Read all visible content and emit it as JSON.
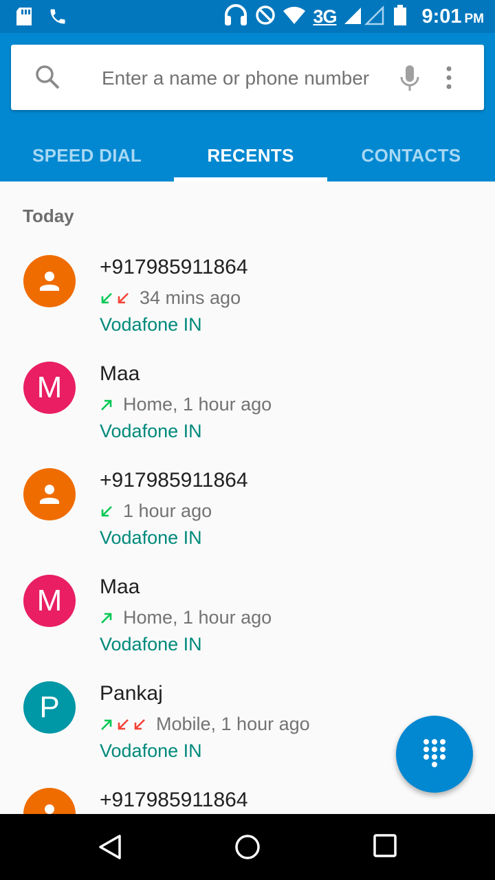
{
  "status_bar": {
    "network": "3G",
    "time": "9:01",
    "ampm": "PM",
    "icons": [
      "sd-card-icon",
      "phone-icon",
      "headset-icon",
      "do-not-disturb-icon",
      "wifi-icon",
      "signal-icon",
      "battery-icon"
    ]
  },
  "search": {
    "placeholder": "Enter a name or phone number",
    "icons": [
      "search-icon",
      "mic-icon",
      "more-vert-icon"
    ]
  },
  "tabs": [
    {
      "label": "SPEED DIAL",
      "active": false
    },
    {
      "label": "RECENTS",
      "active": true
    },
    {
      "label": "CONTACTS",
      "active": false
    }
  ],
  "section_header": "Today",
  "calls": [
    {
      "name": "+917985911864",
      "avatar": "person",
      "avatar_color": "#ef6c00",
      "arrows": [
        "incoming",
        "missed"
      ],
      "detail": "34 mins ago",
      "carrier": "Vodafone IN"
    },
    {
      "name": "Maa",
      "avatar": "M",
      "avatar_color": "#e91e63",
      "arrows": [
        "outgoing"
      ],
      "detail": "Home, 1 hour ago",
      "carrier": "Vodafone IN"
    },
    {
      "name": "+917985911864",
      "avatar": "person",
      "avatar_color": "#ef6c00",
      "arrows": [
        "incoming"
      ],
      "detail": "1 hour ago",
      "carrier": "Vodafone IN"
    },
    {
      "name": "Maa",
      "avatar": "M",
      "avatar_color": "#e91e63",
      "arrows": [
        "outgoing"
      ],
      "detail": "Home, 1 hour ago",
      "carrier": "Vodafone IN"
    },
    {
      "name": "Pankaj",
      "avatar": "P",
      "avatar_color": "#0097a7",
      "arrows": [
        "outgoing",
        "missed",
        "missed"
      ],
      "detail": "Mobile, 1 hour ago",
      "carrier": "Vodafone IN"
    },
    {
      "name": "+917985911864",
      "avatar": "person",
      "avatar_color": "#ef6c00",
      "arrows": [],
      "detail": "",
      "carrier": ""
    }
  ],
  "fab": {
    "icon": "dialpad-icon"
  },
  "nav": {
    "icons": [
      "back-icon",
      "home-icon",
      "recents-icon"
    ]
  },
  "colors": {
    "primary": "#0288d1",
    "status_bar": "#0277bd",
    "carrier_text": "#00897b",
    "arrow_incoming_outgoing": "#00c853",
    "arrow_missed": "#f44336"
  }
}
